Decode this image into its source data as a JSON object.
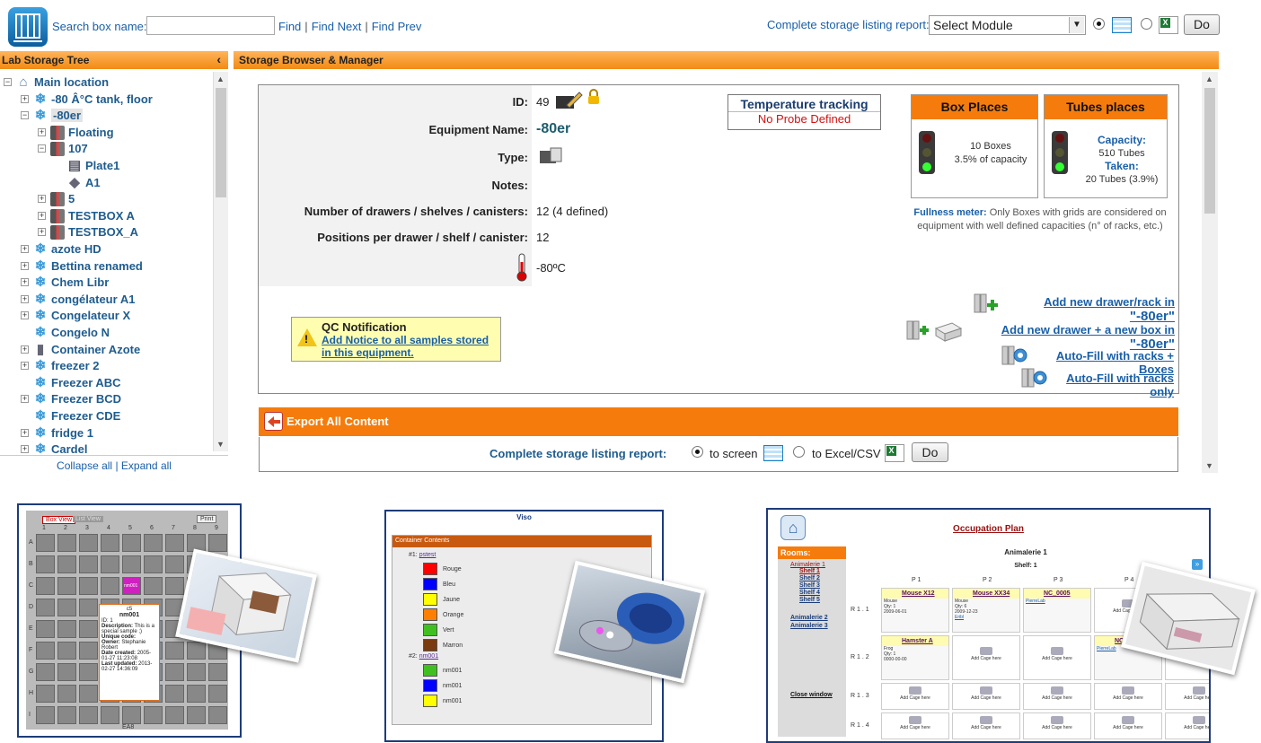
{
  "top": {
    "search_label": "Search box name:",
    "search_value": "",
    "find": "Find",
    "find_next": "Find Next",
    "find_prev": "Find Prev",
    "separator": "|",
    "report_label": "Complete storage listing report:",
    "module_select": "Select Module",
    "do": "Do"
  },
  "tree": {
    "header": "Lab Storage Tree",
    "collapse": "Collapse all",
    "expand": "Expand all",
    "sep": "|",
    "nodes": [
      {
        "label": "Main location",
        "icon": "house-icon"
      },
      {
        "label": "-80 Â°C tank, floor",
        "icon": "snowflake-icon"
      },
      {
        "label": "-80er",
        "icon": "snowflake-icon"
      },
      {
        "label": "Floating",
        "icon": "freezer-icon"
      },
      {
        "label": "107",
        "icon": "freezer-icon"
      },
      {
        "label": "Plate1",
        "icon": "plate-icon"
      },
      {
        "label": "A1",
        "icon": "tube-icon"
      },
      {
        "label": "5",
        "icon": "freezer-icon"
      },
      {
        "label": "TESTBOX A",
        "icon": "freezer-icon"
      },
      {
        "label": "TESTBOX_A",
        "icon": "freezer-icon"
      },
      {
        "label": "azote HD",
        "icon": "snowflake-icon"
      },
      {
        "label": "Bettina renamed",
        "icon": "snowflake-icon"
      },
      {
        "label": "Chem Libr",
        "icon": "snowflake-icon"
      },
      {
        "label": "congélateur A1",
        "icon": "snowflake-icon"
      },
      {
        "label": "Congelateur X",
        "icon": "snowflake-icon"
      },
      {
        "label": "Congelo N",
        "icon": "snowflake-icon"
      },
      {
        "label": "Container Azote",
        "icon": "tank-icon"
      },
      {
        "label": "freezer 2",
        "icon": "snowflake-icon"
      },
      {
        "label": "Freezer ABC",
        "icon": "snowflake-icon"
      },
      {
        "label": "Freezer BCD",
        "icon": "snowflake-icon"
      },
      {
        "label": "Freezer CDE",
        "icon": "snowflake-icon"
      },
      {
        "label": "fridge 1",
        "icon": "snowflake-icon"
      },
      {
        "label": "Cardel",
        "icon": "snowflake-icon"
      }
    ]
  },
  "browser": {
    "header": "Storage Browser & Manager",
    "fields": {
      "id_label": "ID:",
      "id_value": "49",
      "name_label": "Equipment Name:",
      "name_value": "-80er",
      "type_label": "Type:",
      "notes_label": "Notes:",
      "drawers_label": "Number of drawers / shelves / canisters:",
      "drawers_value": "12 (4 defined)",
      "positions_label": "Positions per drawer / shelf / canister:",
      "positions_value": "12",
      "temp_value": "-80ºC"
    },
    "temperature": {
      "title": "Temperature tracking",
      "status": "No Probe Defined"
    },
    "box_places": {
      "title": "Box Places",
      "line1": "10 Boxes",
      "line2": "3.5% of capacity"
    },
    "tube_places": {
      "title": "Tubes places",
      "capacity_label": "Capacity:",
      "capacity": "510 Tubes",
      "taken_label": "Taken:",
      "taken": "20 Tubes (3.9%)"
    },
    "fullness": {
      "label": "Fullness meter:",
      "text": "Only Boxes with grids are considered on equipment with well defined capacities (n° of racks, etc.)"
    },
    "qc": {
      "title": "QC Notification",
      "link": "Add Notice to all samples stored in this equipment."
    },
    "actions": {
      "add_drawer": "Add new drawer/rack in",
      "add_drawer_box": "Add new drawer + a new box in",
      "equip_quoted": "\"-80er\"",
      "autofill_boxes": "Auto-Fill with racks + Boxes",
      "autofill_racks": "Auto-Fill with racks only"
    },
    "export": {
      "title": "Export All Content",
      "report_label": "Complete storage listing report:",
      "to_screen": "to screen",
      "to_excel": "to Excel/CSV",
      "do": "Do"
    }
  },
  "thumb1": {
    "tab_box": "Box View",
    "tab_list": "List View",
    "print": "Print",
    "cols": [
      "1",
      "2",
      "3",
      "4",
      "5",
      "6",
      "7",
      "8",
      "9"
    ],
    "rows": [
      "A",
      "B",
      "C",
      "D",
      "E",
      "F",
      "G",
      "H",
      "I"
    ],
    "cell_label": "nm001",
    "tip_code": "c5",
    "tip_name": "nm001",
    "tip_id": "ID: 1",
    "tip_desc_label": "Description:",
    "tip_desc": "This is a special sample ;)",
    "tip_code_label": "Unique code:",
    "tip_owner_label": "Owner:",
    "tip_owner": "Stephanie Robert",
    "tip_created_label": "Date created:",
    "tip_created": "2005-01-27 11:23:08",
    "tip_updated_label": "Last updated:",
    "tip_updated": "2013-02-27 14:36:09",
    "footer": "EA8"
  },
  "thumb2": {
    "title": "Viso",
    "header": "Container Contents",
    "group1": "#1:",
    "group1_link": "pstest",
    "items1": [
      {
        "label": "Rouge",
        "color": "#ff0000"
      },
      {
        "label": "Bleu",
        "color": "#0000ff"
      },
      {
        "label": "Jaune",
        "color": "#ffff00"
      },
      {
        "label": "Orange",
        "color": "#ff8000"
      },
      {
        "label": "Vert",
        "color": "#40c020"
      },
      {
        "label": "Marron",
        "color": "#7a3b10"
      }
    ],
    "group2": "#2:",
    "group2_link": "nm001",
    "items2": [
      {
        "label": "nm001",
        "color": "#40c020"
      },
      {
        "label": "nm001",
        "color": "#0000ff"
      },
      {
        "label": "nm001",
        "color": "#ffff00"
      }
    ]
  },
  "thumb3": {
    "title": "Occupation Plan",
    "rooms_label": "Rooms:",
    "room1": "Animalerie 1",
    "shelves": [
      "Shelf 1",
      "Shelf 2",
      "Shelf 3",
      "Shelf 4",
      "Shelf 5"
    ],
    "room2": "Animalerie 2",
    "room3": "Animalerie 3",
    "close": "Close window",
    "heading": "Animalerie 1",
    "shelf": "Shelf: 1",
    "cols": [
      "P 1",
      "P 2",
      "P 3",
      "P 4"
    ],
    "rows": [
      "R 1 . 1",
      "R 1 . 2",
      "R 1 . 3",
      "R 1 . 4"
    ],
    "add_cage": "Add Cage here",
    "cages": [
      {
        "name": "Mouse X12",
        "species": "Mouse",
        "qty": "Qty: 1",
        "date": "2009-06-01",
        "owner": ""
      },
      {
        "name": "Mouse XX34",
        "species": "Mouse",
        "qty": "Qty: 6",
        "date": "2009-12-23",
        "owner": "Eribl"
      },
      {
        "name": "NC_0005",
        "species": "",
        "qty": "",
        "date": "",
        "owner": "PierreLab"
      },
      {
        "name": "Hamster A",
        "species": "Frog",
        "qty": "Qty: 1",
        "date": "0000-00-00",
        "owner": ""
      },
      {
        "name": "NC_0",
        "species": "",
        "qty": "",
        "date": "",
        "owner": "PierreLab"
      }
    ]
  }
}
